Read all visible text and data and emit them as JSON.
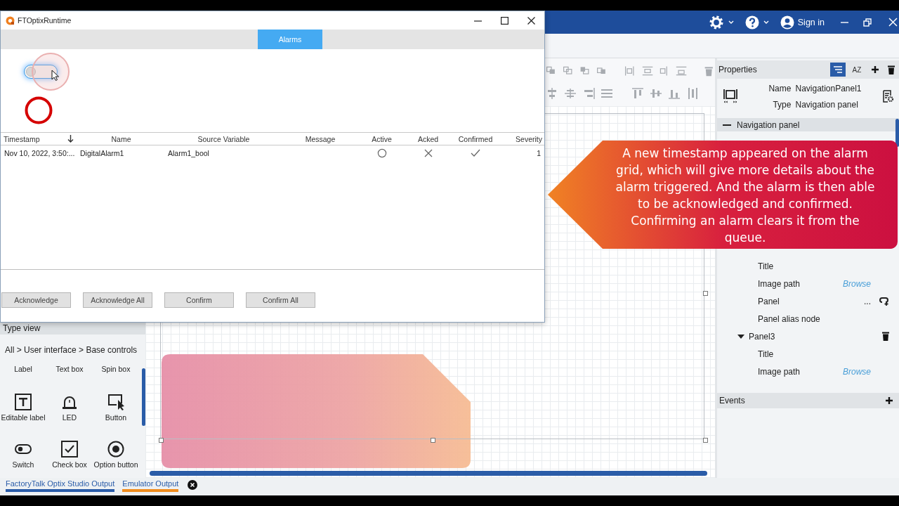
{
  "runtime_window": {
    "title": "FTOptixRuntime",
    "tabs": [
      {
        "label": "Alarms",
        "selected": true
      }
    ],
    "switch": {
      "on": false
    },
    "led": {
      "on": false
    },
    "alarm_grid": {
      "columns": [
        "Timestamp",
        "Name",
        "Source Variable",
        "Message",
        "Active",
        "Acked",
        "Confirmed",
        "Severity"
      ],
      "rows": [
        {
          "timestamp": "Nov 10, 2022, 3:50:...",
          "name": "DigitalAlarm1",
          "source_variable": "Alarm1_bool",
          "active": false,
          "acked": false,
          "confirmed": true,
          "severity": "1"
        }
      ]
    },
    "buttons": [
      "Acknowledge",
      "Acknowledge All",
      "Confirm",
      "Confirm All"
    ]
  },
  "studio": {
    "title_bar": {
      "sign_in": "Sign in"
    },
    "type_view": {
      "title": "Type view",
      "breadcrumb": "All > User interface > Base controls",
      "items": [
        {
          "label": "Label",
          "kind": "text"
        },
        {
          "label": "Text box",
          "kind": "text"
        },
        {
          "label": "Spin box",
          "kind": "text"
        },
        {
          "label": "Editable label",
          "kind": "editable-label"
        },
        {
          "label": "LED",
          "kind": "led"
        },
        {
          "label": "Button",
          "kind": "button"
        },
        {
          "label": "Switch",
          "kind": "switch"
        },
        {
          "label": "Check box",
          "kind": "checkbox"
        },
        {
          "label": "Option button",
          "kind": "option"
        }
      ]
    },
    "properties": {
      "title": "Properties",
      "sort_label": "AZ",
      "name_label": "Name",
      "name": "NavigationPanel1",
      "type_label": "Type",
      "type": "Navigation panel",
      "section": "Navigation panel",
      "tree": [
        {
          "label": "Title",
          "kind": "field"
        },
        {
          "label": "Image path",
          "kind": "browse",
          "action": "Browse"
        },
        {
          "label": "Panel",
          "kind": "link",
          "action": "..."
        },
        {
          "label": "Panel alias node",
          "kind": "field"
        },
        {
          "label": "Panel3",
          "kind": "node",
          "expanded": true,
          "children": [
            {
              "label": "Title",
              "kind": "field"
            },
            {
              "label": "Image path",
              "kind": "browse",
              "action": "Browse"
            }
          ]
        }
      ],
      "events": "Events"
    },
    "output_tabs": [
      {
        "label": "FactoryTalk Optix Studio Output",
        "selected": false
      },
      {
        "label": "Emulator Output",
        "selected": true
      }
    ]
  },
  "callout": {
    "text": "A new timestamp appeared on the alarm grid, which will give more details about the alarm triggered. And the alarm is then able to be acknowledged and confirmed. Confirming an alarm clears it from the queue."
  }
}
